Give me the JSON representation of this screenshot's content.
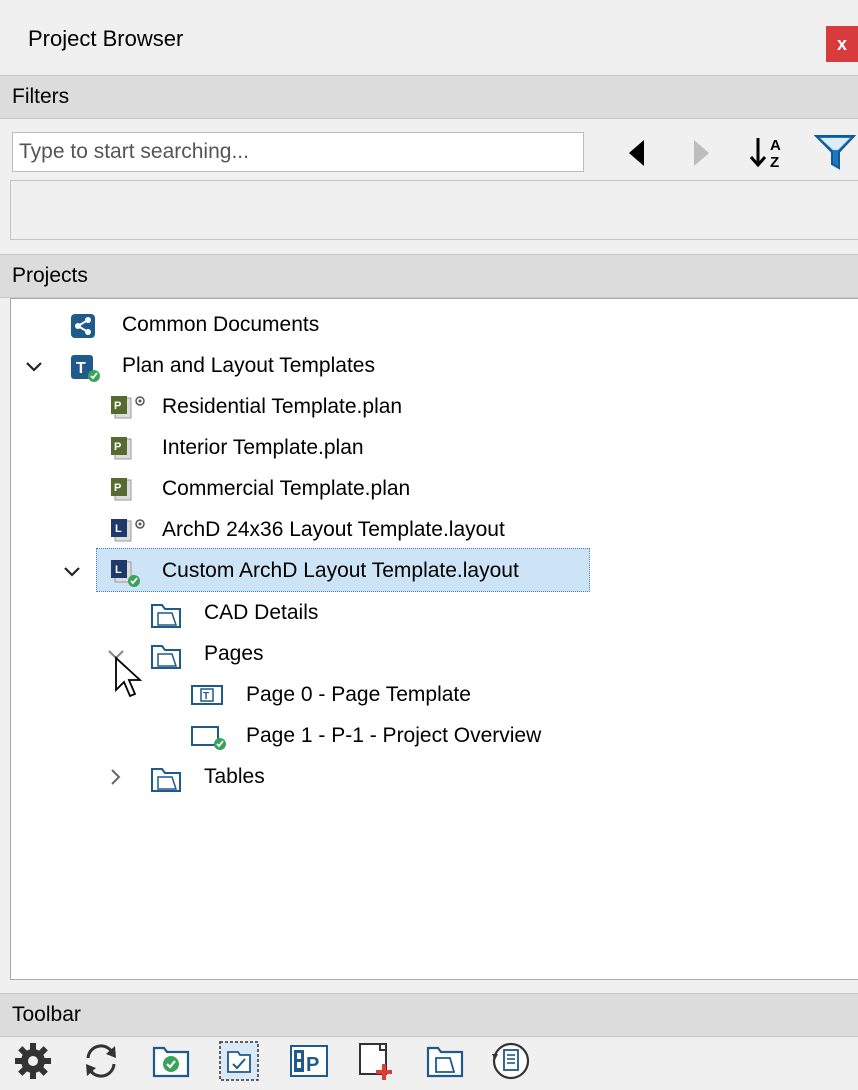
{
  "window": {
    "title": "Project Browser",
    "close_label": "x"
  },
  "filters": {
    "header": "Filters",
    "search_placeholder": "Type to start searching..."
  },
  "projects": {
    "header": "Projects",
    "tree": {
      "common": "Common Documents",
      "plan_layout": "Plan and Layout Templates",
      "residential": "Residential Template.plan",
      "interior": "Interior Template.plan",
      "commercial": "Commercial Template.plan",
      "archd": "ArchD 24x36 Layout Template.layout",
      "custom": "Custom ArchD Layout Template.layout",
      "cad_details": "CAD Details",
      "pages": "Pages",
      "page0": "Page 0 - Page Template",
      "page1": "Page 1 - P-1 - Project Overview",
      "tables": "Tables"
    }
  },
  "toolbar": {
    "header": "Toolbar"
  },
  "colors": {
    "accent_blue": "#1e5a8c",
    "check_green": "#3aa35a",
    "close_red": "#d83b3b"
  }
}
